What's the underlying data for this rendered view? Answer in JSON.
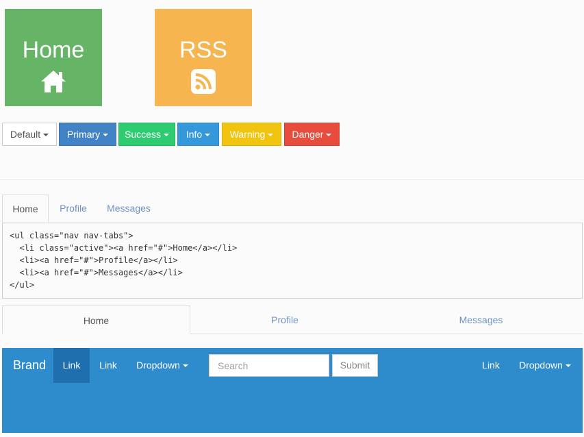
{
  "tiles": [
    {
      "label": "Home",
      "icon": "home-icon",
      "color": "#66b466"
    },
    {
      "label": "RSS",
      "icon": "rss-icon",
      "color": "#f6b54e"
    }
  ],
  "dropdown_buttons": [
    {
      "label": "Default",
      "bg": "#ffffff",
      "fg": "#555555",
      "border": "#cccccc"
    },
    {
      "label": "Primary",
      "bg": "#4183c4",
      "fg": "#ffffff",
      "border": "#3a76b0"
    },
    {
      "label": "Success",
      "bg": "#2ecc71",
      "fg": "#ffffff",
      "border": "#28b463"
    },
    {
      "label": "Info",
      "bg": "#3498db",
      "fg": "#ffffff",
      "border": "#2e89c6"
    },
    {
      "label": "Warning",
      "bg": "#f1c40f",
      "fg": "#ffffff",
      "border": "#d9b00d"
    },
    {
      "label": "Danger",
      "bg": "#e74c3c",
      "fg": "#ffffff",
      "border": "#d04436"
    }
  ],
  "nav_tabs": {
    "items": [
      "Home",
      "Profile",
      "Messages"
    ],
    "active": "Home",
    "code": "<ul class=\"nav nav-tabs\">\n  <li class=\"active\"><a href=\"#\">Home</a></li>\n  <li><a href=\"#\">Profile</a></li>\n  <li><a href=\"#\">Messages</a></li>\n</ul>"
  },
  "justified_tabs": {
    "items": [
      "Home",
      "Profile",
      "Messages"
    ],
    "active": "Home"
  },
  "navbar": {
    "brand": "Brand",
    "link_active": "Link",
    "link": "Link",
    "dropdown": "Dropdown",
    "search_placeholder": "Search",
    "submit": "Submit",
    "right_link": "Link",
    "right_dropdown": "Dropdown",
    "color": "#2e8ccc"
  }
}
